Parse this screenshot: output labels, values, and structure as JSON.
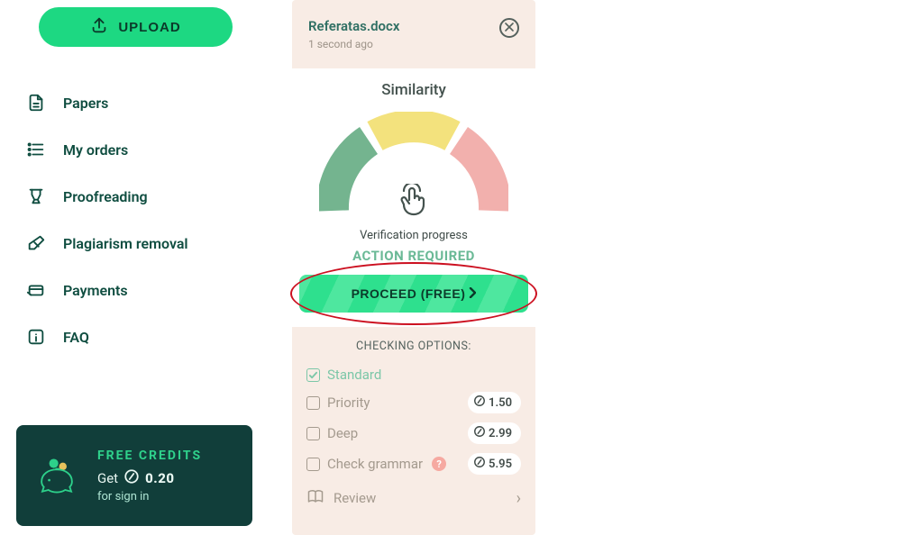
{
  "upload": {
    "label": "UPLOAD"
  },
  "nav": [
    {
      "id": "papers",
      "label": "Papers"
    },
    {
      "id": "orders",
      "label": "My orders"
    },
    {
      "id": "proofreading",
      "label": "Proofreading"
    },
    {
      "id": "plagiarism",
      "label": "Plagiarism removal"
    },
    {
      "id": "payments",
      "label": "Payments"
    },
    {
      "id": "faq",
      "label": "FAQ"
    }
  ],
  "credits": {
    "title": "FREE CREDITS",
    "get": "Get",
    "amount": "0.20",
    "sub": "for sign in"
  },
  "card": {
    "filename": "Referatas.docx",
    "ago": "1 second ago",
    "similarity_title": "Similarity",
    "verification_label": "Verification progress",
    "action_required": "ACTION REQUIRED",
    "proceed_label": "PROCEED (FREE)",
    "options_title": "CHECKING OPTIONS:",
    "options": {
      "standard": {
        "label": "Standard"
      },
      "priority": {
        "label": "Priority",
        "price": "1.50"
      },
      "deep": {
        "label": "Deep",
        "price": "2.99"
      },
      "grammar": {
        "label": "Check grammar",
        "price": "5.95"
      }
    },
    "review_label": "Review"
  }
}
